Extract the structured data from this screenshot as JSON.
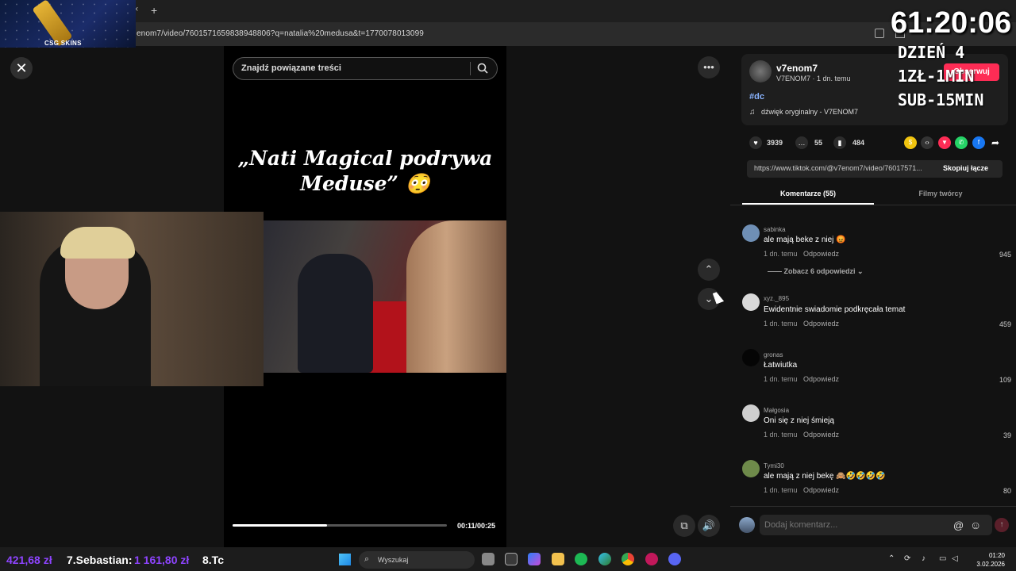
{
  "browser": {
    "tab_close": "×",
    "new_tab": "+",
    "url": "enom7/video/7601571659838948806?q=natalia%20medusa&t=1770078013099"
  },
  "overlay": {
    "sponsor": "CSG SKINS",
    "timer": "61:20:06",
    "day": "DZIEŃ 4",
    "rate": "1ZŁ-1MIN",
    "sub": "SUB-15MIN"
  },
  "player": {
    "close": "✕",
    "search_placeholder": "Znajdź powiązane treści",
    "title": "„Nati Magical podrywa Meduse” 😳",
    "time": "00:11/00:25",
    "progress": 0.44,
    "more": "•••",
    "up": "⌃",
    "down": "⌄",
    "pip": "⧉",
    "volume": "🔊"
  },
  "post": {
    "author": "v7enom7",
    "author_sub": "V7ENOM7 · 1 dn. temu",
    "follow": "Obserwuj",
    "hashtag": "#dc",
    "music": "dźwięk oryginalny - V7ENOM7",
    "likes": "3939",
    "comments": "55",
    "saves": "484",
    "link": "https://www.tiktok.com/@v7enom7/video/76017571...",
    "copy_link": "Skopiuj łącze"
  },
  "tabs": {
    "comments": "Komentarze (55)",
    "videos": "Filmy twórcy"
  },
  "comments": [
    {
      "user": "sabinka",
      "text": "ale mają beke z niej 😡",
      "time": "1 dn. temu",
      "reply": "Odpowiedz",
      "likes": "945",
      "avatar": "#6f8fb5"
    },
    {
      "user": "xyz._895",
      "text": "Ewidentnie swiadomie podkręcała temat",
      "time": "1 dn. temu",
      "reply": "Odpowiedz",
      "likes": "459",
      "avatar": "#d9d9d9"
    },
    {
      "user": "gronas",
      "text": "Łatwiutka",
      "time": "1 dn. temu",
      "reply": "Odpowiedz",
      "likes": "109",
      "avatar": "#050505"
    },
    {
      "user": "Małgosia",
      "text": "Oni się z niej śmieją",
      "time": "1 dn. temu",
      "reply": "Odpowiedz",
      "likes": "39",
      "avatar": "#cfcfcf"
    },
    {
      "user": "Tymi30",
      "text": "ale mają z niej bekę 🙈🤣🤣🤣🤣",
      "time": "1 dn. temu",
      "reply": "Odpowiedz",
      "likes": "80",
      "avatar": "#6e8a4a"
    }
  ],
  "view_replies": "—— Zobacz 6 odpowiedzi ⌄",
  "compose": {
    "placeholder": "Dodaj komentarz...",
    "at": "@",
    "emoji": "☺",
    "post": "↑"
  },
  "taskbar": {
    "donor_1_amount": "421,68 zł",
    "donor_2_name": "7.Sebastian:",
    "donor_2_amount": "1 161,80 zł",
    "donor_3_name": "8.Tc",
    "search": "Wyszukaj",
    "time": "01:20",
    "date": "3.02.2026"
  }
}
